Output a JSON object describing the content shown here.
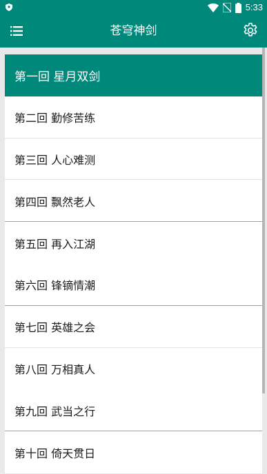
{
  "status_bar": {
    "time": "5:33",
    "icons": [
      "shield-icon",
      "wifi-icon",
      "no-sim-icon",
      "battery-icon"
    ]
  },
  "app_bar": {
    "title": "苍穹神剑",
    "menu_icon": "list-icon",
    "settings_icon": "gear-icon"
  },
  "colors": {
    "primary": "#00897b",
    "background": "#e9e9e9",
    "text": "#1a1a1a"
  },
  "chapters": [
    {
      "label": "第一回 星月双剑",
      "selected": true
    },
    {
      "label": "第二回 勤修苦练",
      "selected": false
    },
    {
      "label": "第三回 人心难测",
      "selected": false
    },
    {
      "label": "第四回 飘然老人",
      "selected": false
    },
    {
      "label": "第五回 再入江湖",
      "selected": false
    },
    {
      "label": "第六回 锋镝情潮",
      "selected": false
    },
    {
      "label": "第七回 英雄之会",
      "selected": false
    },
    {
      "label": "第八回 万相真人",
      "selected": false
    },
    {
      "label": "第九回 武当之行",
      "selected": false
    },
    {
      "label": "第十回 倚天贯日",
      "selected": false
    }
  ]
}
